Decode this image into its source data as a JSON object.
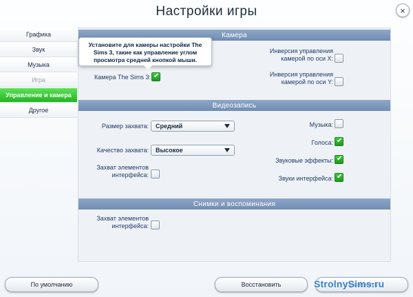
{
  "window": {
    "title": "Настройки игры",
    "close": "×"
  },
  "sidebar": {
    "items": [
      {
        "label": "Графика",
        "state": "normal"
      },
      {
        "label": "Звук",
        "state": "normal"
      },
      {
        "label": "Музыка",
        "state": "normal"
      },
      {
        "label": "Игра",
        "state": "disabled"
      },
      {
        "label": "Управление и камера",
        "state": "active"
      },
      {
        "label": "Другое",
        "state": "normal"
      }
    ]
  },
  "camera": {
    "header": "Камера",
    "tooltip": "Установите для камеры настройки The Sims 3, такие как управление углом просмотра средней кнопкой мыши.",
    "sims3_camera": {
      "label": "Камера The Sims 3:",
      "checked": true
    },
    "invert_x": {
      "label_line1": "Инверсия управления",
      "label_line2": "камерой по оси X:",
      "checked": false
    },
    "invert_y": {
      "label_line1": "Инверсия управления",
      "label_line2": "камерой по оси Y:",
      "checked": false
    }
  },
  "video": {
    "header": "Видеозапись",
    "capture_size": {
      "label": "Размер захвата:",
      "value": "Средний"
    },
    "capture_quality": {
      "label": "Качество захвата:",
      "value": "Высокое"
    },
    "capture_ui": {
      "label_line1": "Захват элементов",
      "label_line2": "интерфейса:",
      "checked": false
    },
    "music": {
      "label": "Музыка:",
      "checked": false
    },
    "voices": {
      "label": "Голоса:",
      "checked": true
    },
    "sfx": {
      "label": "Звуковые эффекты:",
      "checked": true
    },
    "ui_sounds": {
      "label": "Звуки интерфейса:",
      "checked": true
    }
  },
  "screenshots": {
    "header": "Снимки и воспоминания",
    "capture_ui": {
      "label_line1": "Захват элементов",
      "label_line2": "интерфейса:",
      "checked": false
    }
  },
  "buttons": {
    "defaults": "По умолчанию",
    "restore": "Восстановить",
    "apply": "Применить"
  },
  "watermark": "StrolnySims.ru",
  "icons": {
    "checkmark": "✔",
    "close": "close-icon",
    "dropdown": "chevron-down-icon"
  },
  "colors": {
    "active_tab": "#22b522",
    "section_header": "#6f8cb3",
    "watermark": "#2e7fd2"
  }
}
